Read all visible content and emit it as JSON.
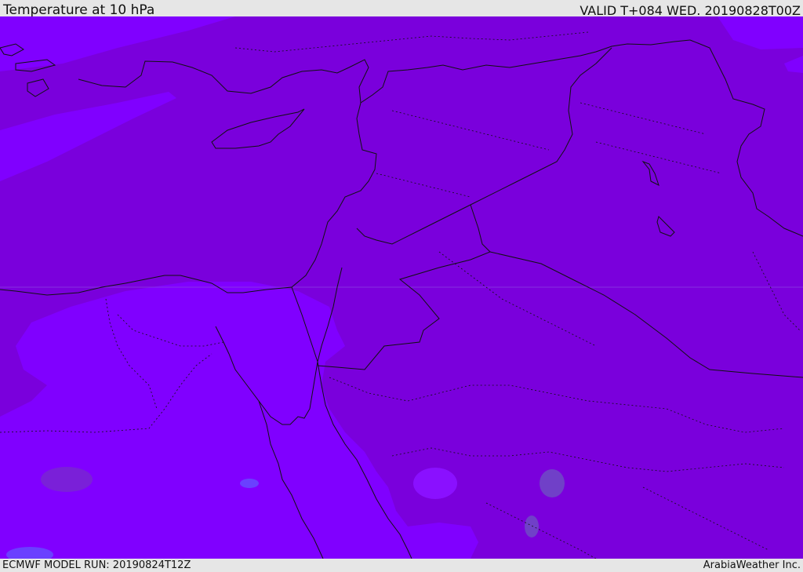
{
  "header": {
    "title": "Temperature at 10 hPa",
    "valid": "VALID T+084 WED. 20190828T00Z"
  },
  "footer": {
    "model_run": "ECMWF MODEL RUN: 20190824T12Z",
    "credit": "ArabiaWeather Inc."
  },
  "colors": {
    "background_dark": "#7a00dc",
    "field_light": "#8000ff",
    "patch_grey": "#7040c8",
    "patch_blue": "#6a40ff",
    "coastline": "#111111",
    "frame": "#e6e6e6"
  }
}
